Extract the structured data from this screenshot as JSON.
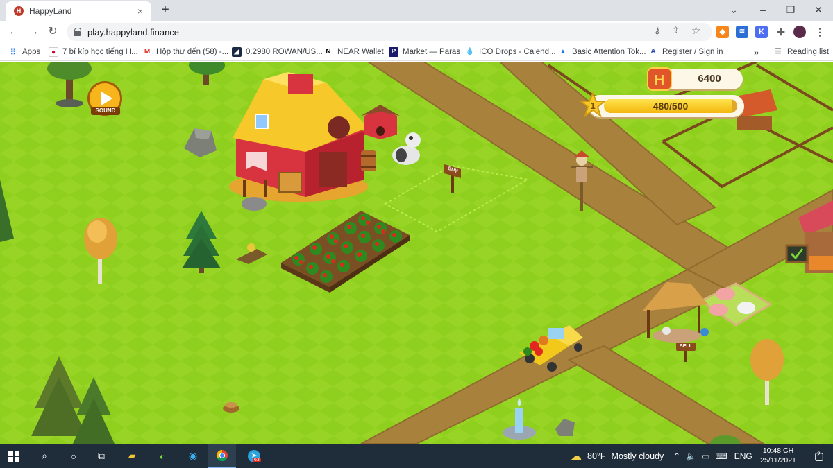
{
  "browser": {
    "tab_title": "HappyLand",
    "tab_favicon_letter": "H",
    "new_tab": "+",
    "url": "play.happyland.finance",
    "window_controls": {
      "collapse": "⌄",
      "minimize": "–",
      "restore": "❐",
      "close": "✕"
    }
  },
  "bookmarks": [
    {
      "label": "Apps",
      "icon": "apps-grid-icon"
    },
    {
      "label": "7 bí kíp học tiếng H...",
      "icon": "korea-flag-icon"
    },
    {
      "label": "Hộp thư đến (58) -...",
      "icon": "gmail-icon"
    },
    {
      "label": "0.2980 ROWAN/US...",
      "icon": "chart-icon"
    },
    {
      "label": "NEAR Wallet",
      "icon": "near-icon"
    },
    {
      "label": "Market — Paras",
      "icon": "paras-icon"
    },
    {
      "label": "ICO Drops - Calend...",
      "icon": "drop-icon"
    },
    {
      "label": "Basic Attention Tok...",
      "icon": "bat-icon"
    },
    {
      "label": "Register / Sign in",
      "icon": "a-logo-icon"
    }
  ],
  "bookmarks_more": "»",
  "reading_list": "Reading list",
  "game": {
    "coins": "6400",
    "coin_icon_letter": "H",
    "level": "1",
    "xp_text": "480/500",
    "xp_fraction": 0.96,
    "sound_label": "SOUND",
    "buy_sign": "BUY",
    "sell_sign": "SELL"
  },
  "taskbar": {
    "weather_temp": "80°F",
    "weather_text": "Mostly cloudy",
    "language": "ENG",
    "time": "10:48 CH",
    "date": "25/11/2021",
    "notifications": "2",
    "telegram_badge": "63"
  },
  "colors": {
    "grass": "#8fcf1e",
    "road": "#a8813d",
    "taskbar": "#1f2d3a",
    "accent": "#e0562a"
  }
}
